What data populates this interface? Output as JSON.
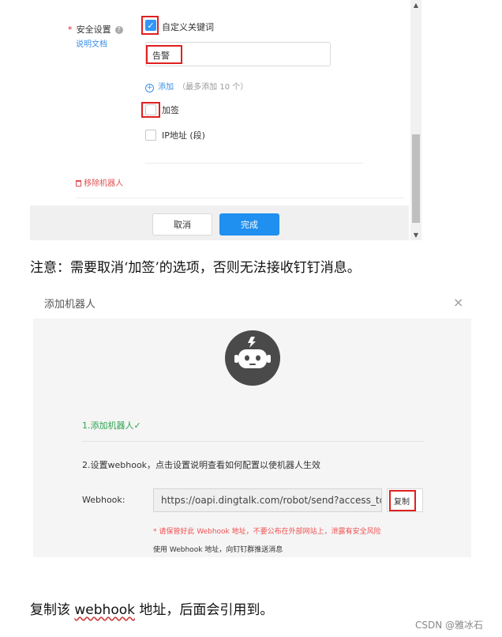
{
  "top_form": {
    "security_label": "安全设置",
    "required_mark": "*",
    "help_mark": "?",
    "docs_link": "说明文档",
    "custom_keyword_label": "自定义关键词",
    "keyword_value": "告警",
    "add_label": "添加",
    "add_limit": "（最多添加 10 个）",
    "sign_label": "加签",
    "ip_label": "IP地址 (段)",
    "remove_robot": "移除机器人",
    "cancel_button": "取消",
    "finish_button": "完成"
  },
  "note_sign": "注意：需要取消‘加签’的选项，否则无法接收钉钉消息。",
  "dialog": {
    "title": "添加机器人",
    "close": "×",
    "step1": "1.添加机器人✓",
    "step2": "2.设置webhook，点击设置说明查看如何配置以使机器人生效",
    "webhook_label": "Webhook:",
    "webhook_value": "https://oapi.dingtalk.com/robot/send?access_tok",
    "copy_button": "复制",
    "warning": "* 请保管好此 Webhook 地址，不要公布在外部网站上，泄露有安全风险",
    "usage": "使用 Webhook 地址，向钉钉群推送消息"
  },
  "note_copy": {
    "prefix": "复制该 ",
    "keyword": "webhook",
    "suffix": " 地址，后面会引用到。"
  },
  "watermark": "CSDN @雅冰石",
  "colors": {
    "primary": "#1f8ff0",
    "checkbox": "#3296fa",
    "highlight": "#e0201f",
    "danger": "#e05050",
    "success": "#2ea44f",
    "robot": "#4a4a4a"
  },
  "icons": {
    "help": "question-circle-icon",
    "add": "plus-circle-icon",
    "remove": "trash-icon",
    "robot": "robot-icon",
    "close": "close-icon",
    "check": "check-icon"
  }
}
